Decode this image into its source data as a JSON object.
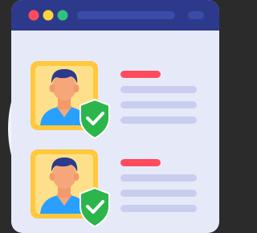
{
  "illustration": {
    "type": "verified-profiles-browser-icon",
    "colors": {
      "background": "#2b2b2b",
      "circle": "#f2f3fb",
      "titlebar": "#2d3a8c",
      "window_body": "#e6eaf8",
      "dot_close": "#ff4b5c",
      "dot_min": "#ffd43b",
      "dot_max": "#2ec27e",
      "addressbar": "#3b4ba8",
      "card_frame": "#ffc83d",
      "shield": "#2bb54a",
      "accent_line": "#ff4b5c",
      "text_line": "#c9ceef"
    },
    "profiles": [
      {
        "name_line": "",
        "verified": true
      },
      {
        "name_line": "",
        "verified": true
      }
    ]
  }
}
